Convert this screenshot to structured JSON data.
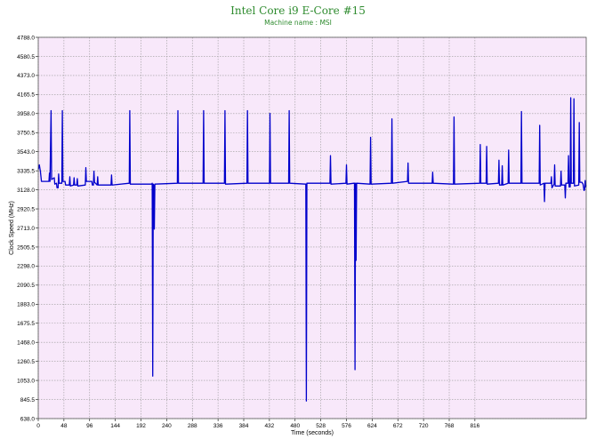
{
  "chart_data": {
    "type": "line",
    "title": "Intel Core i9 E-Core #15",
    "subtitle": "Machine name : MSI",
    "xlabel": "Time (seconds)",
    "ylabel": "Clock Speed (MHz)",
    "xlim": [
      0,
      832
    ],
    "ylim": [
      638.0,
      4788.0
    ],
    "x_ticks": [
      0,
      48,
      96,
      144,
      192,
      240,
      288,
      336,
      384,
      432,
      480,
      528,
      576,
      624,
      672,
      720,
      768,
      816
    ],
    "y_ticks": [
      638.0,
      845.5,
      1053.0,
      1260.5,
      1468.0,
      1675.5,
      1883.0,
      2090.5,
      2298.0,
      2505.5,
      2713.0,
      2920.5,
      3128.0,
      3335.5,
      3543.0,
      3750.5,
      3958.0,
      4165.5,
      4373.0,
      4580.5,
      4788.0
    ],
    "grid": true,
    "colors": {
      "title": "#2e8b2e",
      "line": "#0000cc",
      "plot_bg": "#f8e8fa",
      "grid": "#9a9a9a"
    },
    "series": [
      {
        "values": [
          [
            0,
            3350
          ],
          [
            2,
            3400
          ],
          [
            4,
            3330
          ],
          [
            6,
            3220
          ],
          [
            20,
            3220
          ],
          [
            21,
            3310
          ],
          [
            22,
            3220
          ],
          [
            24,
            3990
          ],
          [
            25,
            3240
          ],
          [
            30,
            3260
          ],
          [
            31,
            3190
          ],
          [
            34,
            3200
          ],
          [
            35,
            3150
          ],
          [
            37,
            3150
          ],
          [
            38,
            3300
          ],
          [
            39,
            3200
          ],
          [
            44,
            3200
          ],
          [
            45,
            3990
          ],
          [
            46,
            3220
          ],
          [
            50,
            3220
          ],
          [
            51,
            3180
          ],
          [
            58,
            3180
          ],
          [
            59,
            3270
          ],
          [
            60,
            3170
          ],
          [
            66,
            3180
          ],
          [
            67,
            3260
          ],
          [
            68,
            3180
          ],
          [
            72,
            3180
          ],
          [
            73,
            3250
          ],
          [
            74,
            3170
          ],
          [
            88,
            3180
          ],
          [
            89,
            3370
          ],
          [
            90,
            3220
          ],
          [
            100,
            3220
          ],
          [
            101,
            3180
          ],
          [
            103,
            3180
          ],
          [
            104,
            3330
          ],
          [
            105,
            3210
          ],
          [
            110,
            3180
          ],
          [
            111,
            3270
          ],
          [
            112,
            3180
          ],
          [
            136,
            3180
          ],
          [
            137,
            3290
          ],
          [
            138,
            3180
          ],
          [
            170,
            3200
          ],
          [
            171,
            3990
          ],
          [
            172,
            3190
          ],
          [
            212,
            3190
          ],
          [
            213,
            3200
          ],
          [
            214,
            1100
          ],
          [
            215,
            3190
          ],
          [
            216,
            3180
          ],
          [
            217,
            2700
          ],
          [
            218,
            3190
          ],
          [
            260,
            3200
          ],
          [
            261,
            3990
          ],
          [
            262,
            3200
          ],
          [
            308,
            3200
          ],
          [
            309,
            3990
          ],
          [
            310,
            3200
          ],
          [
            348,
            3200
          ],
          [
            349,
            3990
          ],
          [
            350,
            3190
          ],
          [
            390,
            3200
          ],
          [
            391,
            3990
          ],
          [
            392,
            3200
          ],
          [
            432,
            3200
          ],
          [
            433,
            3960
          ],
          [
            434,
            3200
          ],
          [
            468,
            3200
          ],
          [
            469,
            3990
          ],
          [
            470,
            3200
          ],
          [
            500,
            3190
          ],
          [
            501,
            830
          ],
          [
            502,
            3200
          ],
          [
            545,
            3200
          ],
          [
            546,
            3500
          ],
          [
            547,
            3190
          ],
          [
            575,
            3200
          ],
          [
            576,
            3400
          ],
          [
            577,
            3190
          ],
          [
            590,
            3200
          ],
          [
            591,
            3200
          ],
          [
            592,
            1170
          ],
          [
            593,
            3200
          ],
          [
            594,
            2360
          ],
          [
            595,
            3200
          ],
          [
            620,
            3190
          ],
          [
            621,
            3700
          ],
          [
            622,
            3190
          ],
          [
            660,
            3200
          ],
          [
            661,
            3900
          ],
          [
            662,
            3200
          ],
          [
            690,
            3220
          ],
          [
            691,
            3420
          ],
          [
            692,
            3200
          ],
          [
            736,
            3200
          ],
          [
            737,
            3320
          ],
          [
            738,
            3200
          ],
          [
            776,
            3190
          ],
          [
            777,
            3920
          ],
          [
            778,
            3190
          ],
          [
            825,
            3200
          ],
          [
            826,
            3620
          ],
          [
            827,
            3200
          ],
          [
            837,
            3200
          ],
          [
            838,
            3600
          ],
          [
            839,
            3190
          ],
          [
            860,
            3200
          ],
          [
            861,
            3450
          ],
          [
            862,
            3180
          ],
          [
            866,
            3180
          ],
          [
            867,
            3390
          ],
          [
            868,
            3180
          ],
          [
            878,
            3200
          ],
          [
            879,
            3560
          ],
          [
            880,
            3200
          ],
          [
            902,
            3200
          ],
          [
            903,
            3980
          ],
          [
            904,
            3200
          ],
          [
            936,
            3200
          ],
          [
            937,
            3830
          ],
          [
            938,
            3180
          ],
          [
            945,
            3200
          ],
          [
            946,
            3000
          ],
          [
            947,
            3200
          ],
          [
            958,
            3200
          ],
          [
            959,
            3270
          ],
          [
            960,
            3150
          ],
          [
            964,
            3190
          ],
          [
            965,
            3400
          ],
          [
            966,
            3170
          ],
          [
            976,
            3170
          ],
          [
            977,
            3330
          ],
          [
            978,
            3180
          ],
          [
            984,
            3180
          ],
          [
            985,
            3040
          ],
          [
            986,
            3200
          ],
          [
            990,
            3200
          ],
          [
            991,
            3500
          ],
          [
            992,
            3160
          ],
          [
            994,
            3160
          ],
          [
            995,
            4130
          ],
          [
            996,
            3200
          ],
          [
            1000,
            3200
          ],
          [
            1001,
            4120
          ],
          [
            1002,
            3170
          ],
          [
            1010,
            3180
          ],
          [
            1011,
            3860
          ],
          [
            1012,
            3210
          ],
          [
            1016,
            3210
          ],
          [
            1017,
            3200
          ],
          [
            1018,
            3190
          ],
          [
            1020,
            3120
          ],
          [
            1021,
            3130
          ],
          [
            1022,
            3230
          ],
          [
            1023,
            3160
          ],
          [
            1024,
            3180
          ]
        ]
      }
    ]
  }
}
